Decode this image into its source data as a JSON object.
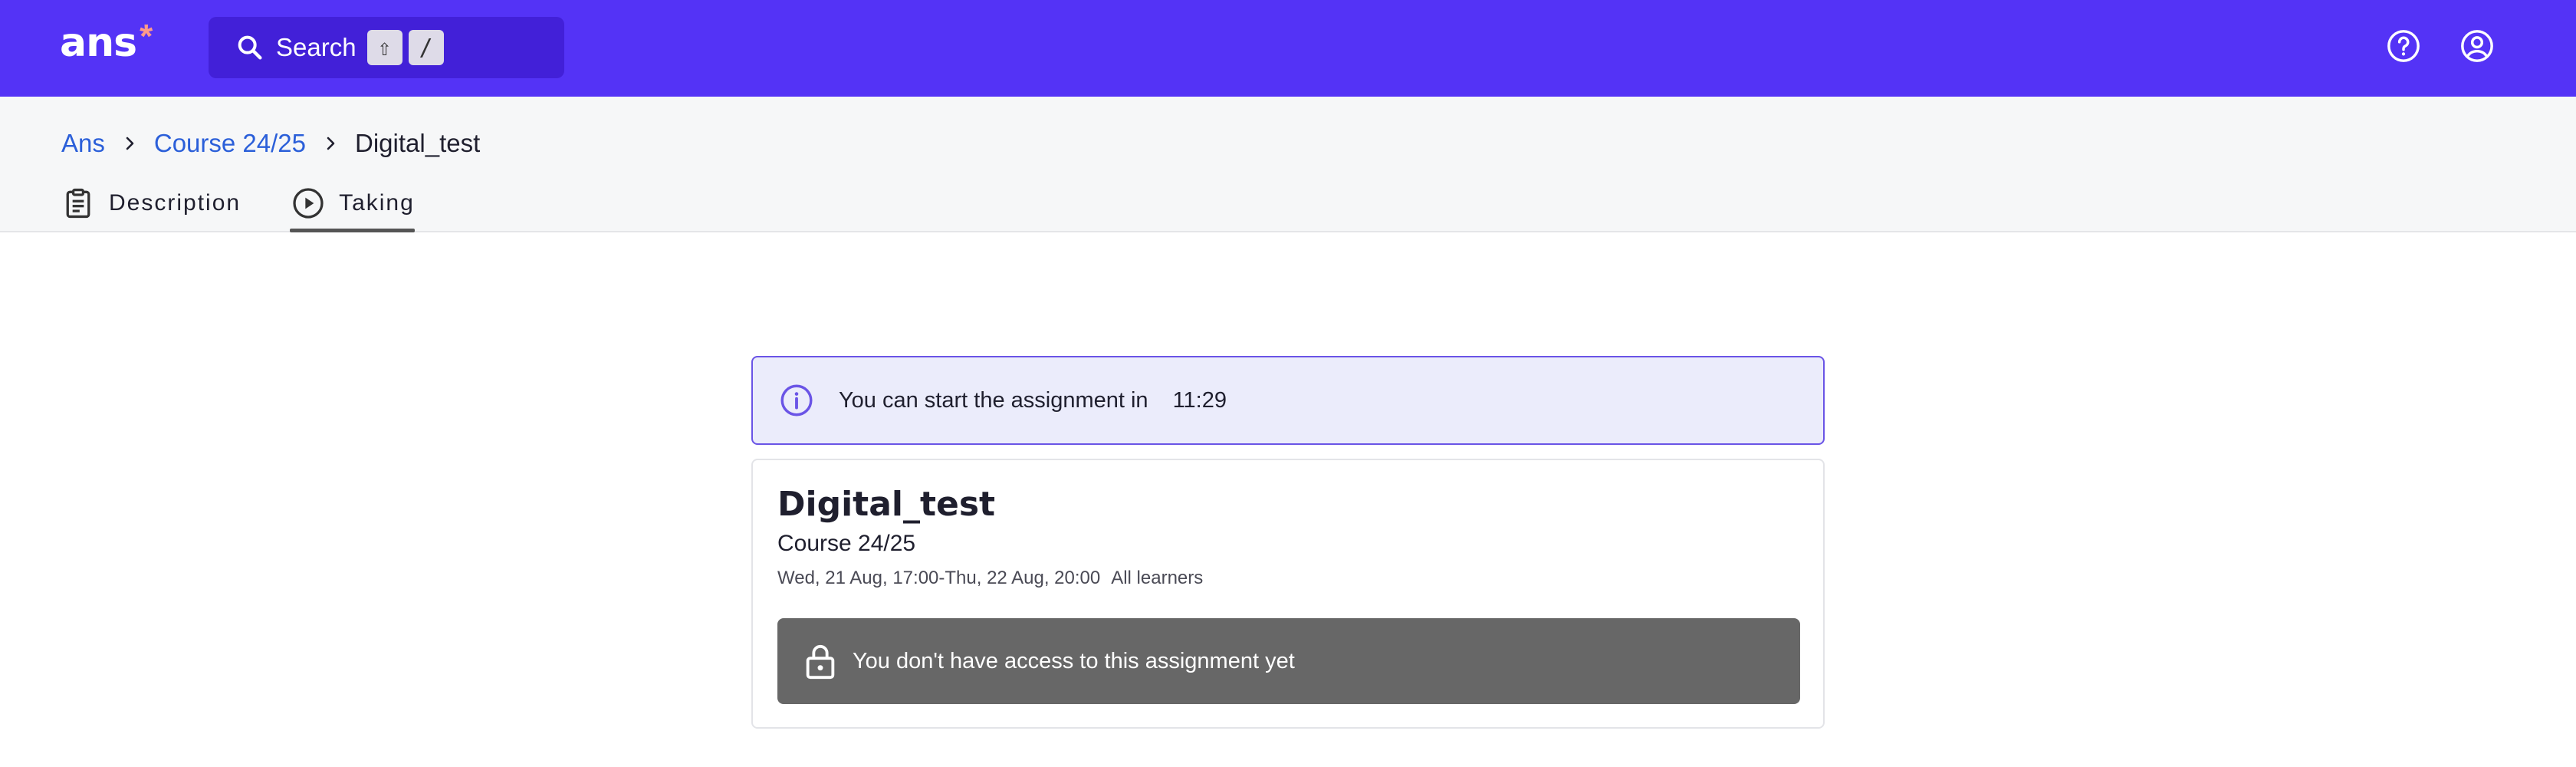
{
  "header": {
    "logo_text": "ans",
    "logo_mark": "*",
    "search_label": "Search",
    "shortcut_keys": [
      "⇧",
      "/"
    ],
    "icons": [
      "search-icon",
      "help-icon",
      "account-icon"
    ]
  },
  "breadcrumb": {
    "items": [
      "Ans",
      "Course 24/25",
      "Digital_test"
    ]
  },
  "tabs": [
    {
      "label": "Description",
      "icon": "clipboard-icon",
      "active": false
    },
    {
      "label": "Taking",
      "icon": "play-circle-icon",
      "active": true
    }
  ],
  "banner": {
    "text": "You can start the assignment in",
    "countdown": "11:29"
  },
  "assignment": {
    "title": "Digital_test",
    "course": "Course 24/25",
    "schedule": "Wed, 21 Aug, 17:00-Thu, 22 Aug, 20:00",
    "audience": "All learners",
    "access_message": "You don't have access to this assignment yet"
  },
  "colors": {
    "topbar": "#5433f6",
    "search_bg": "#4220d8",
    "link": "#2b5fd9",
    "banner_bg": "#ebecfb",
    "banner_border": "#6a54e6",
    "locked_bg": "#676767"
  }
}
